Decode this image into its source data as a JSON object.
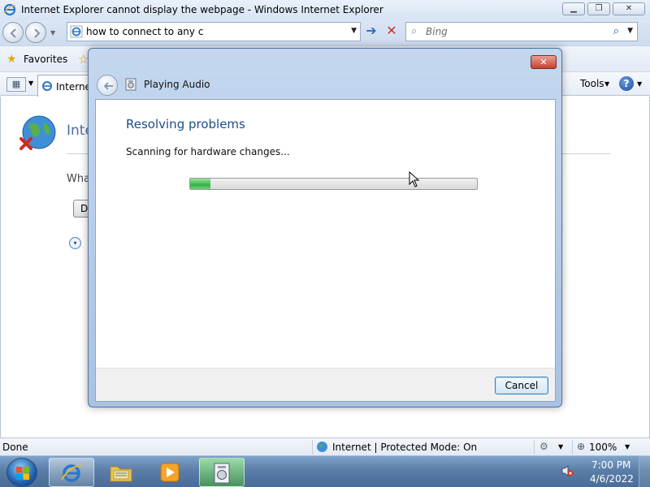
{
  "window": {
    "title": "Internet Explorer cannot display the webpage - Windows Internet Explorer",
    "controls": {
      "minimize": "▁",
      "maximize": "❐",
      "close": "✕"
    }
  },
  "navbar": {
    "address": "how to connect to any c",
    "search_placeholder": "Bing",
    "icons": [
      "back-icon",
      "forward-icon",
      "ie-page-icon",
      "go-icon",
      "stop-icon",
      "search-icon"
    ]
  },
  "favorites_bar": {
    "label": "Favorites"
  },
  "command_bar": {
    "tab_label": "Internet",
    "tools_label": "Tools",
    "help_glyph": "?"
  },
  "page": {
    "heading": "Inte",
    "question": "Wha",
    "diagnose_button": "D",
    "more_info_glyph": "▾"
  },
  "status_bar": {
    "status": "Done",
    "zone": "Internet | Protected Mode: On",
    "zoom": "100%"
  },
  "dialog": {
    "title": "Playing Audio",
    "heading": "Resolving problems",
    "status": "Scanning for hardware changes...",
    "progress_fraction": 0.07,
    "cancel_label": "Cancel",
    "close_glyph": "✕"
  },
  "taskbar": {
    "buttons": [
      "internet-explorer",
      "windows-explorer",
      "windows-media-player",
      "troubleshooter"
    ],
    "clock_time": "7:00 PM",
    "clock_date": "4/6/2022"
  },
  "colors": {
    "dialog_heading": "#1f4c8c",
    "progress_fill": "#37b34a",
    "taskbar": "#5a7ea8"
  }
}
